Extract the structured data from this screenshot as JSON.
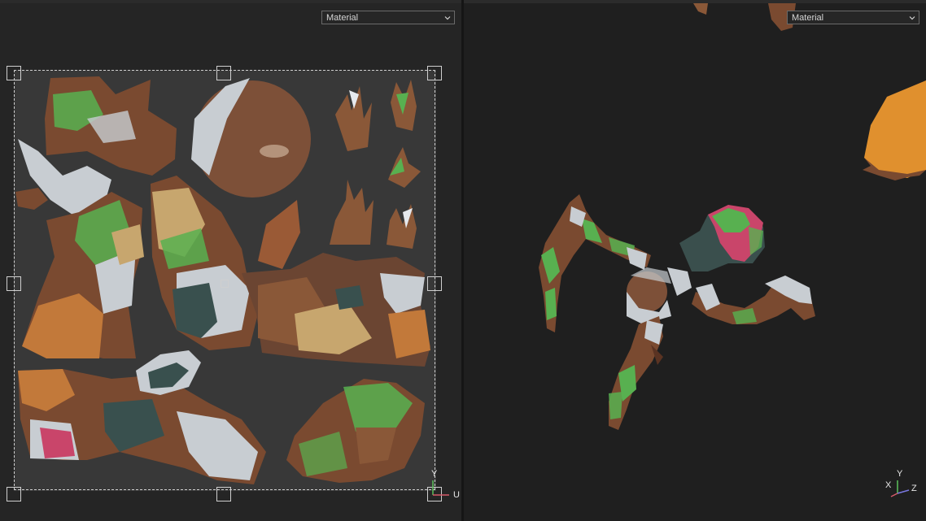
{
  "uv_editor": {
    "display_mode": "Material"
  },
  "viewport": {
    "display_mode": "Material"
  },
  "uv_gizmo": {
    "u_label": "U",
    "v_label": "Y"
  },
  "viewport_gizmo": {
    "x_label": "X",
    "y_label": "Y",
    "z_label": "Z"
  },
  "colors": {
    "panel_bg": "#252525",
    "uv_bg": "#383838",
    "bark_brown": "#7a4a30",
    "skin_white": "#c8cdd2",
    "moss_green": "#58b050",
    "dark_teal": "#39504e",
    "orange": "#c2793a",
    "tan": "#c7a66e",
    "pink": "#c9456a"
  },
  "icons": [
    "chevron-down-icon",
    "uv-axis-gizmo-icon",
    "view-axis-gizmo-icon"
  ]
}
